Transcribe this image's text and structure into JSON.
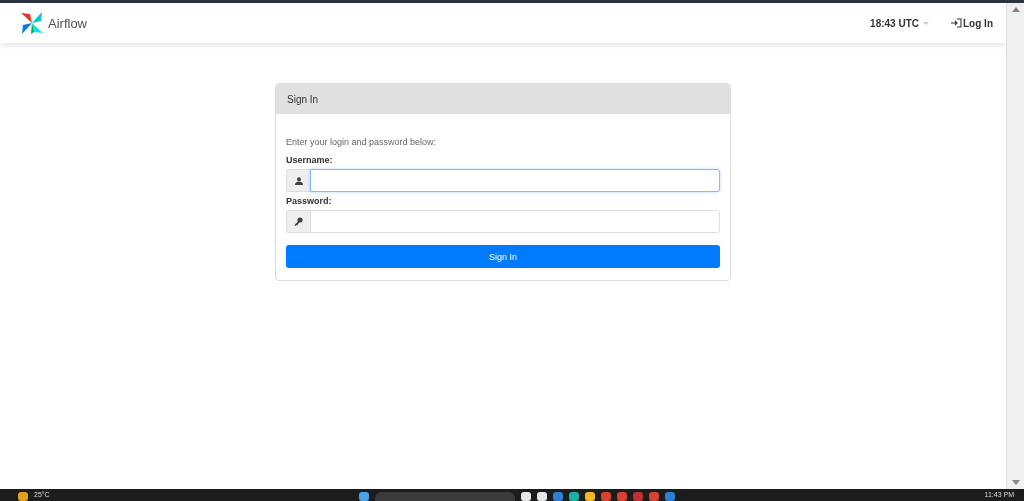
{
  "navbar": {
    "brand": "Airflow",
    "clock": "18:43 UTC",
    "login": "Log In"
  },
  "card": {
    "title": "Sign In",
    "intro": "Enter your login and password below:",
    "fields": [
      {
        "kind": "user",
        "label": "Username:",
        "focused": true
      },
      {
        "kind": "key",
        "label": "Password:",
        "focused": false
      }
    ],
    "button": "Sign In"
  },
  "taskbar": {
    "weather": "25°C",
    "time": "11:43 PM"
  }
}
